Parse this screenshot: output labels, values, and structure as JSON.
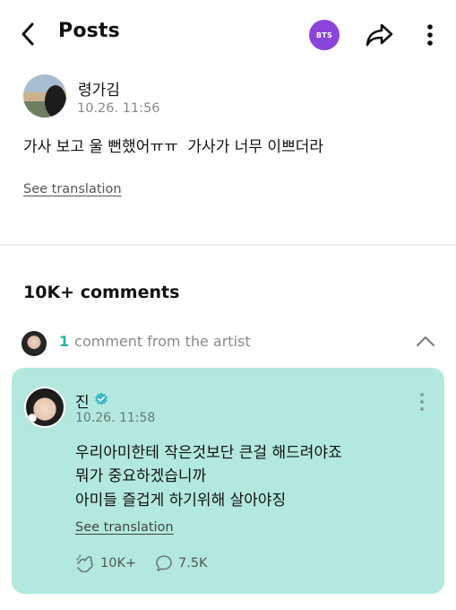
{
  "header": {
    "title": "Posts",
    "community_badge": "BTS",
    "back_icon": "chevron-left-icon",
    "share_icon": "share-arrow-icon",
    "more_icon": "vertical-dots-icon"
  },
  "post": {
    "author": "령가김",
    "time": "10.26. 11:56",
    "body": "가사 보고 울 뻔했어ㅠㅠ  가사가 너무 이쁘더라",
    "see_translation": "See translation"
  },
  "comments": {
    "count_label": "10K+ comments",
    "artist_count": "1",
    "artist_label": "comment from the artist"
  },
  "artist_comment": {
    "name": "진",
    "time": "10.26. 11:58",
    "lines": [
      "우리아미한테 작은것보단 큰걸 해드려야죠",
      "뭐가 중요하겠습니까",
      "아미들 즐겁게 하기위해 살아야징"
    ],
    "see_translation": "See translation",
    "likes": "10K+",
    "replies": "7.5K"
  },
  "colors": {
    "accent": "#21b6a8",
    "card_bg": "#b2e8dd",
    "badge_bg": "#8a44d9",
    "verified": "#3ab8c9"
  }
}
